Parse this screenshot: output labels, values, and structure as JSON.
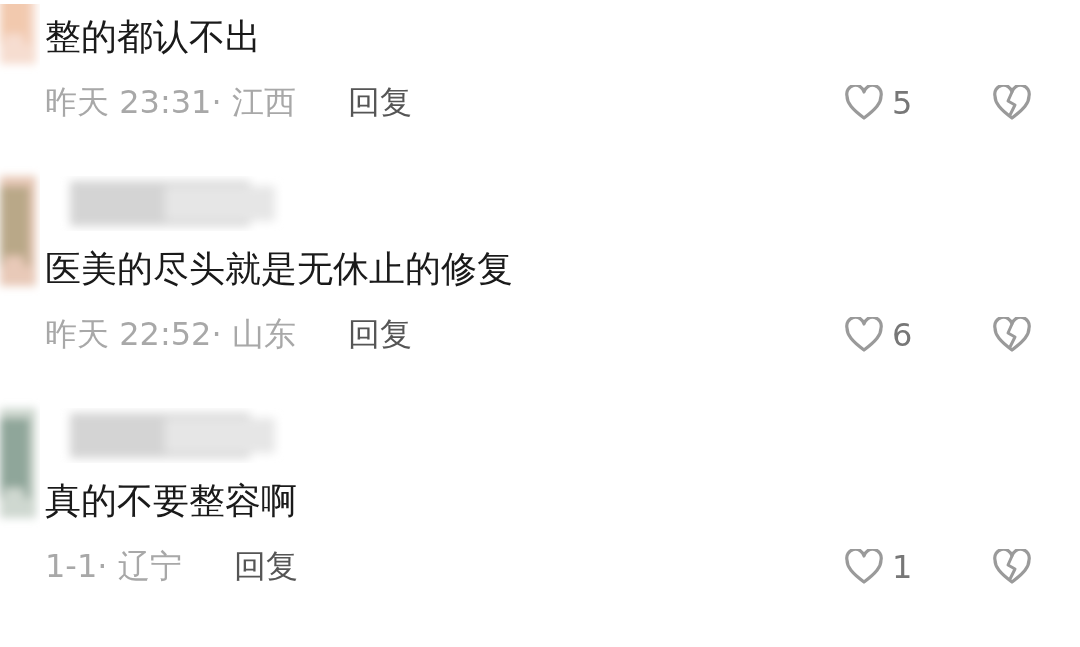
{
  "comments": [
    {
      "header_visible": false,
      "text": "整的都认不出",
      "meta": "昨天 23:31· 江西",
      "reply": "回复",
      "likes": "5"
    },
    {
      "header_visible": true,
      "text": "医美的尽头就是无休止的修复",
      "meta": "昨天 22:52· 山东",
      "reply": "回复",
      "likes": "6"
    },
    {
      "header_visible": true,
      "text": "真的不要整容啊",
      "meta": "1-1· 辽宁",
      "reply": "回复",
      "likes": "1"
    }
  ]
}
